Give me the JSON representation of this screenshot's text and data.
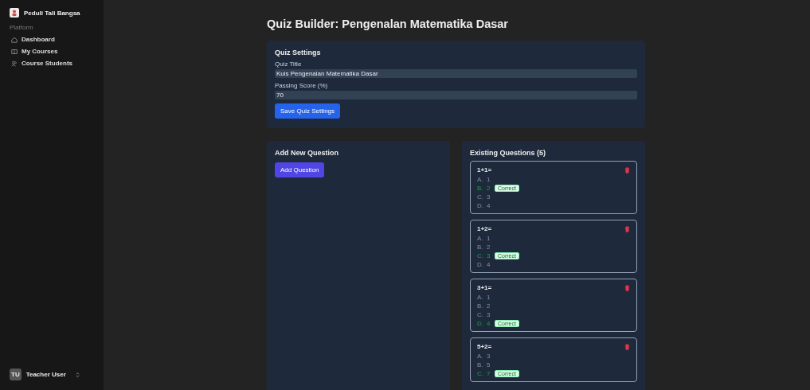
{
  "sidebar": {
    "app_name": "Peduli Tali Bangsa",
    "section": "Platform",
    "items": [
      {
        "label": "Dashboard",
        "selected": false
      },
      {
        "label": "My Courses",
        "selected": false
      },
      {
        "label": "Course Students",
        "selected": false
      }
    ],
    "user": {
      "initials": "TU",
      "name": "Teacher User"
    }
  },
  "title": "Quiz Builder: Pengenalan Matematika Dasar",
  "settings": {
    "heading": "Quiz Settings",
    "fields": [
      {
        "label": "Quiz Title",
        "value": "Kuis Pengenalan Matematika Dasar"
      },
      {
        "label": "Passing Score (%)",
        "value": "70"
      }
    ],
    "button": "Save Quiz Settings"
  },
  "add_question": {
    "heading": "Add New Question",
    "button": "Add Question"
  },
  "existing": {
    "heading": "Existing Questions (5)",
    "questions": [
      {
        "text": "1+1=",
        "options": [
          {
            "letter": "A.",
            "value": "1",
            "correct": false
          },
          {
            "letter": "B.",
            "value": "2",
            "correct": true,
            "badge": "Correct"
          },
          {
            "letter": "C.",
            "value": "3",
            "correct": false
          },
          {
            "letter": "D.",
            "value": "4",
            "correct": false
          }
        ]
      },
      {
        "text": "1+2=",
        "options": [
          {
            "letter": "A.",
            "value": "1",
            "correct": false
          },
          {
            "letter": "B.",
            "value": "2",
            "correct": false
          },
          {
            "letter": "C.",
            "value": "3",
            "correct": true,
            "badge": "Correct"
          },
          {
            "letter": "D.",
            "value": "4",
            "correct": false
          }
        ]
      },
      {
        "text": "3+1=",
        "options": [
          {
            "letter": "A.",
            "value": "1",
            "correct": false
          },
          {
            "letter": "B.",
            "value": "2",
            "correct": false
          },
          {
            "letter": "C.",
            "value": "3",
            "correct": false
          },
          {
            "letter": "D.",
            "value": "4",
            "correct": true,
            "badge": "Correct"
          }
        ]
      },
      {
        "text": "5+2=",
        "options": [
          {
            "letter": "A.",
            "value": "3",
            "correct": false
          },
          {
            "letter": "B.",
            "value": "5",
            "correct": false
          },
          {
            "letter": "C.",
            "value": "7",
            "correct": true,
            "badge": "Correct"
          }
        ]
      }
    ]
  }
}
